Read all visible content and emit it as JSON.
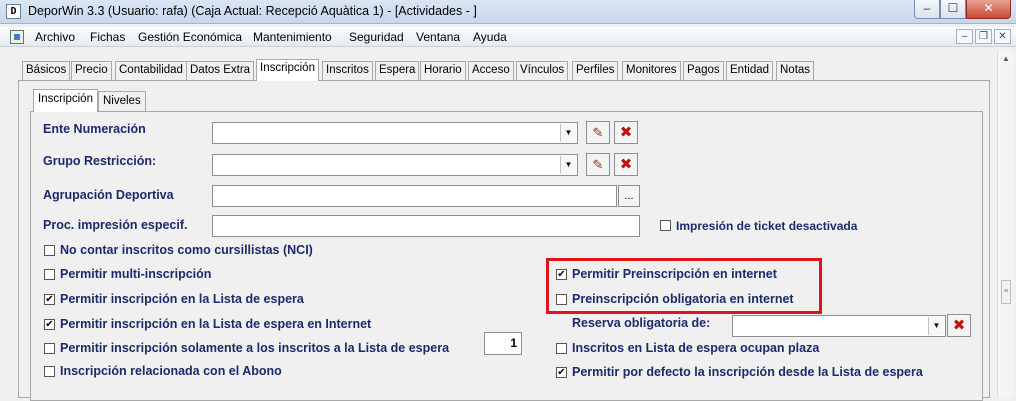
{
  "window": {
    "app_icon": "D",
    "title": "DeporWin 3.3  (Usuario: rafa)  (Caja Actual: Recepció Aquàtica 1) - [Actividades - ]",
    "buttons": {
      "minimize": "–",
      "maximize": "☐",
      "close": "✕"
    }
  },
  "menubar": {
    "items": [
      "Archivo",
      "Fichas",
      "Gestión Económica",
      "Mantenimiento",
      "Seguridad",
      "Ventana",
      "Ayuda"
    ],
    "mdi_buttons": {
      "minimize": "–",
      "restore": "❐",
      "close": "✕"
    }
  },
  "tabs": [
    "Básicos",
    "Precio",
    "Contabilidad",
    "Datos Extra",
    "Inscripción",
    "Inscritos",
    "Espera",
    "Horario",
    "Acceso",
    "Vínculos",
    "Perfiles",
    "Monitores",
    "Pagos",
    "Entidad",
    "Notas"
  ],
  "active_tab": "Inscripción",
  "subtabs": [
    "Inscripción",
    "Niveles"
  ],
  "form": {
    "ente_numeracion": {
      "label": "Ente Numeración",
      "value": ""
    },
    "grupo_restriccion": {
      "label": "Grupo Restricción:",
      "value": ""
    },
    "agrupacion_deportiva": {
      "label": "Agrupación Deportiva",
      "value": "",
      "button": "..."
    },
    "proc_impresion": {
      "label": "Proc. impresión especif.",
      "value": ""
    },
    "impresion_ticket": {
      "label": "Impresión de ticket desactivada",
      "checked": false
    },
    "reserva_obligatoria": {
      "label": "Reserva obligatoria de:",
      "value": ""
    },
    "spin_value": "1"
  },
  "checks_left": [
    {
      "label": "No contar inscritos como cursillistas (NCI)",
      "checked": false
    },
    {
      "label": "Permitir multi-inscripción",
      "checked": false
    },
    {
      "label": "Permitir inscripción en la Lista de espera",
      "checked": true
    },
    {
      "label": "Permitir inscripción en la Lista de espera en Internet",
      "checked": true
    },
    {
      "label": "Permitir inscripción solamente a los inscritos a la Lista de espera",
      "checked": false
    },
    {
      "label": "Inscripción relacionada con el Abono",
      "checked": false
    }
  ],
  "checks_right": [
    {
      "label": "Permitir Preinscripción en internet",
      "checked": true
    },
    {
      "label": "Preinscripción obligatoria en internet",
      "checked": false
    },
    {
      "label": "Inscritos en Lista de espera ocupan plaza",
      "checked": false
    },
    {
      "label": "Permitir por defecto la inscripción desde la Lista de espera",
      "checked": true
    }
  ],
  "icons": {
    "edit": "✎",
    "delete": "✖",
    "dropdown": "▼",
    "check": "✔",
    "scroll_up": "▲",
    "scroll_grip": "≡"
  }
}
